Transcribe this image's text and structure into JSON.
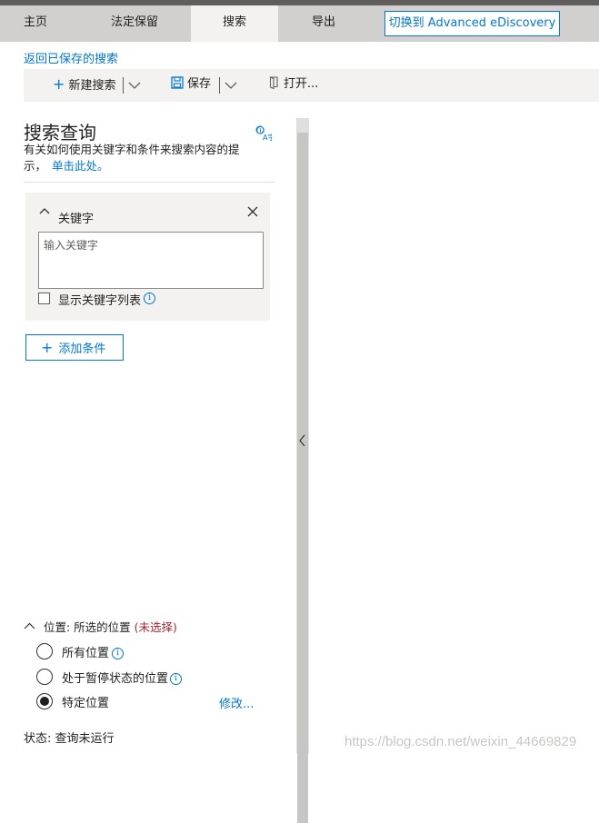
{
  "tabs": [
    {
      "label": "主页"
    },
    {
      "label": "法定保留"
    },
    {
      "label": "搜索"
    },
    {
      "label": "导出"
    }
  ],
  "switch_button": {
    "label": "切换到 Advanced eDiscovery"
  },
  "back_link": "返回已保存的搜索",
  "toolbar": {
    "new_search": "新建搜索",
    "save": "保存",
    "open": "打开..."
  },
  "search_query": {
    "title": "搜索查询",
    "help_text": "有关如何使用关键字和条件来搜索内容的提示，",
    "help_link": "单击此处。"
  },
  "keyword_card": {
    "title": "关键字",
    "input_placeholder": "输入关键字",
    "show_list_label": "显示关键字列表"
  },
  "add_condition": "添加条件",
  "locations": {
    "label": "位置: 所选的位置",
    "unselected": "(未选择)",
    "options": [
      {
        "label": "所有位置",
        "selected": false
      },
      {
        "label": "处于暂停状态的位置",
        "selected": false
      },
      {
        "label": "特定位置",
        "selected": true
      }
    ],
    "modify_link": "修改..."
  },
  "status": "状态: 查询未运行",
  "watermark": "https://blog.csdn.net/weixin_44669829"
}
